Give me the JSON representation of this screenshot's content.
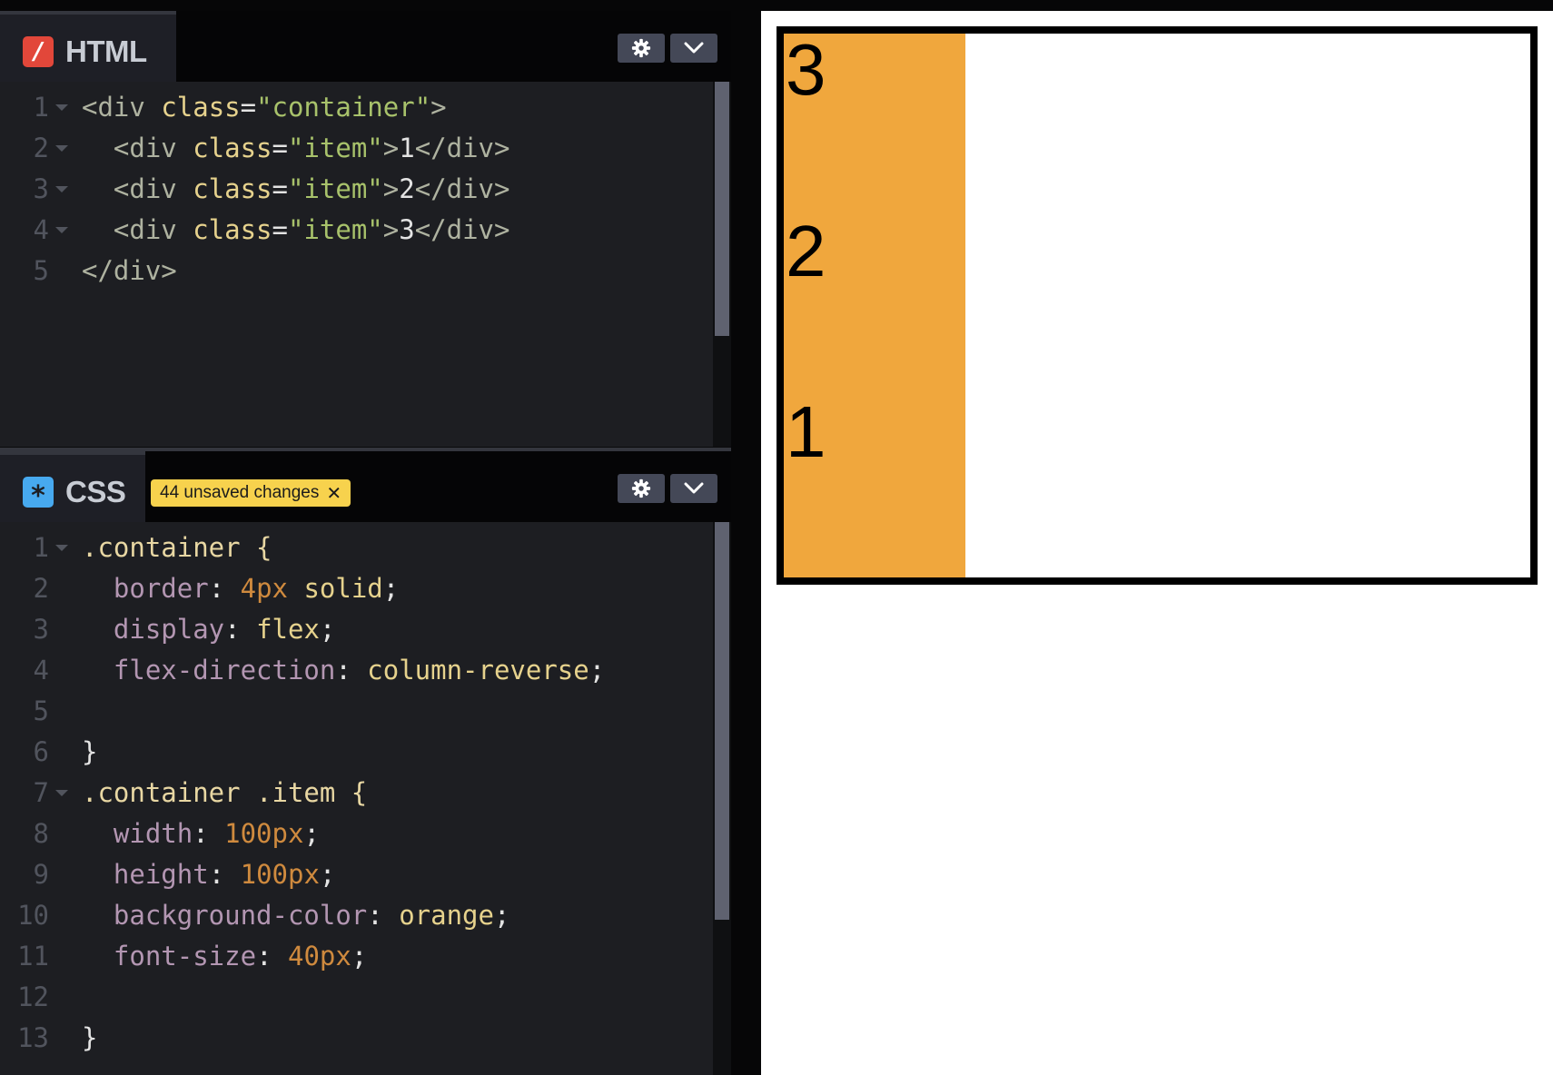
{
  "colors": {
    "html_icon": "#e2473a",
    "css_icon": "#47a9ef",
    "badge": "#f7d24d",
    "tag": "#aeb2a0",
    "attr": "#e6d28d",
    "string": "#a8c26b",
    "selector": "#e8d7a3",
    "property": "#b396b2",
    "number": "#cf8a3e",
    "keyword": "#e6d28d",
    "punct": "#e3e3e3",
    "item_bg": "#f0a73d"
  },
  "html_panel": {
    "icon_symbol": "/",
    "icon": "slash-icon",
    "title": "HTML",
    "lines": [
      {
        "n": "1",
        "fold": true,
        "segs": [
          {
            "t": "<div ",
            "c": "tag"
          },
          {
            "t": "class",
            "c": "attr"
          },
          {
            "t": "=",
            "c": "punct"
          },
          {
            "t": "\"container\"",
            "c": "string"
          },
          {
            "t": ">",
            "c": "tag"
          }
        ]
      },
      {
        "n": "2",
        "fold": true,
        "segs": [
          {
            "t": "  <div ",
            "c": "tag"
          },
          {
            "t": "class",
            "c": "attr"
          },
          {
            "t": "=",
            "c": "punct"
          },
          {
            "t": "\"item\"",
            "c": "string"
          },
          {
            "t": ">",
            "c": "tag"
          },
          {
            "t": "1",
            "c": "punct"
          },
          {
            "t": "</div>",
            "c": "tag"
          }
        ]
      },
      {
        "n": "3",
        "fold": true,
        "segs": [
          {
            "t": "  <div ",
            "c": "tag"
          },
          {
            "t": "class",
            "c": "attr"
          },
          {
            "t": "=",
            "c": "punct"
          },
          {
            "t": "\"item\"",
            "c": "string"
          },
          {
            "t": ">",
            "c": "tag"
          },
          {
            "t": "2",
            "c": "punct"
          },
          {
            "t": "</div>",
            "c": "tag"
          }
        ]
      },
      {
        "n": "4",
        "fold": true,
        "segs": [
          {
            "t": "  <div ",
            "c": "tag"
          },
          {
            "t": "class",
            "c": "attr"
          },
          {
            "t": "=",
            "c": "punct"
          },
          {
            "t": "\"item\"",
            "c": "string"
          },
          {
            "t": ">",
            "c": "tag"
          },
          {
            "t": "3",
            "c": "punct"
          },
          {
            "t": "</div>",
            "c": "tag"
          }
        ]
      },
      {
        "n": "5",
        "fold": false,
        "segs": [
          {
            "t": "</div>",
            "c": "tag"
          }
        ]
      }
    ]
  },
  "css_panel": {
    "icon_symbol": "*",
    "icon": "asterisk-icon",
    "title": "CSS",
    "badge_label": "44 unsaved changes",
    "badge_close": "✕",
    "lines": [
      {
        "n": "1",
        "fold": true,
        "segs": [
          {
            "t": ".container {",
            "c": "selector"
          }
        ]
      },
      {
        "n": "2",
        "fold": false,
        "segs": [
          {
            "t": "  border",
            "c": "property"
          },
          {
            "t": ": ",
            "c": "punct"
          },
          {
            "t": "4px",
            "c": "number"
          },
          {
            "t": " solid",
            "c": "keyword"
          },
          {
            "t": ";",
            "c": "punct"
          }
        ]
      },
      {
        "n": "3",
        "fold": false,
        "segs": [
          {
            "t": "  display",
            "c": "property"
          },
          {
            "t": ": ",
            "c": "punct"
          },
          {
            "t": "flex",
            "c": "keyword"
          },
          {
            "t": ";",
            "c": "punct"
          }
        ]
      },
      {
        "n": "4",
        "fold": false,
        "segs": [
          {
            "t": "  flex-direction",
            "c": "property"
          },
          {
            "t": ": ",
            "c": "punct"
          },
          {
            "t": "column-reverse",
            "c": "keyword"
          },
          {
            "t": ";",
            "c": "punct"
          }
        ]
      },
      {
        "n": "5",
        "fold": false,
        "segs": []
      },
      {
        "n": "6",
        "fold": false,
        "segs": [
          {
            "t": "}",
            "c": "punct"
          }
        ]
      },
      {
        "n": "7",
        "fold": true,
        "segs": [
          {
            "t": ".container .item {",
            "c": "selector"
          }
        ]
      },
      {
        "n": "8",
        "fold": false,
        "segs": [
          {
            "t": "  width",
            "c": "property"
          },
          {
            "t": ": ",
            "c": "punct"
          },
          {
            "t": "100px",
            "c": "number"
          },
          {
            "t": ";",
            "c": "punct"
          }
        ]
      },
      {
        "n": "9",
        "fold": false,
        "segs": [
          {
            "t": "  height",
            "c": "property"
          },
          {
            "t": ": ",
            "c": "punct"
          },
          {
            "t": "100px",
            "c": "number"
          },
          {
            "t": ";",
            "c": "punct"
          }
        ]
      },
      {
        "n": "10",
        "fold": false,
        "segs": [
          {
            "t": "  background-color",
            "c": "property"
          },
          {
            "t": ": ",
            "c": "punct"
          },
          {
            "t": "orange",
            "c": "keyword"
          },
          {
            "t": ";",
            "c": "punct"
          }
        ]
      },
      {
        "n": "11",
        "fold": false,
        "segs": [
          {
            "t": "  font-size",
            "c": "property"
          },
          {
            "t": ": ",
            "c": "punct"
          },
          {
            "t": "40px",
            "c": "number"
          },
          {
            "t": ";",
            "c": "punct"
          }
        ]
      },
      {
        "n": "12",
        "fold": false,
        "segs": []
      },
      {
        "n": "13",
        "fold": false,
        "segs": [
          {
            "t": "}",
            "c": "punct"
          }
        ]
      }
    ]
  },
  "header_buttons": {
    "settings_icon": "gear-icon",
    "collapse_icon": "chevron-down-icon"
  },
  "preview": {
    "items": [
      "1",
      "2",
      "3"
    ]
  }
}
